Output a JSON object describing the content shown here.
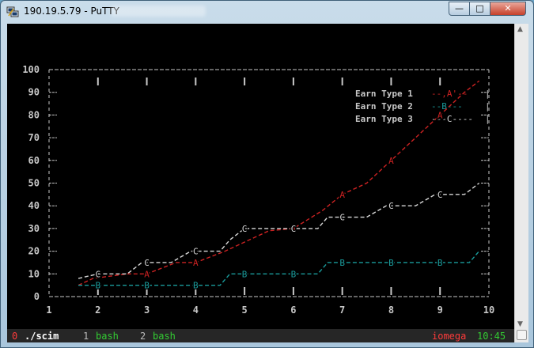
{
  "window": {
    "title": "190.19.5.79 - PuTTY",
    "controls": [
      "minimize-icon",
      "maximize-icon",
      "close-icon"
    ]
  },
  "colors": {
    "terminal_bg": "#000000",
    "axis": "#c8c8c8",
    "series_a": "#cc2222",
    "series_b": "#1a9c9c",
    "series_c": "#d8d8d8",
    "status_green": "#33cc33",
    "status_red": "#ff3b3b"
  },
  "chart_data": {
    "type": "line",
    "x": [
      1,
      2,
      3,
      4,
      5,
      6,
      7,
      8,
      9,
      10
    ],
    "xlim": [
      1,
      10
    ],
    "ylim": [
      0,
      100
    ],
    "y_ticks": [
      0,
      10,
      20,
      30,
      40,
      50,
      60,
      70,
      80,
      90,
      100
    ],
    "x_ticks": [
      1,
      2,
      3,
      4,
      5,
      6,
      7,
      8,
      9,
      10
    ],
    "legend_placement": "top-right",
    "series": [
      {
        "name": "Earn Type 1",
        "marker": "A",
        "line_style": "--,A'--",
        "points": [
          [
            1.6,
            5
          ],
          [
            1.9,
            8
          ],
          [
            2.6,
            10
          ],
          [
            3,
            10
          ],
          [
            3.6,
            15
          ],
          [
            4,
            15
          ],
          [
            4.6,
            20
          ],
          [
            5.5,
            29
          ],
          [
            6,
            30
          ],
          [
            6.6,
            38
          ],
          [
            7,
            45
          ],
          [
            7.5,
            50
          ],
          [
            8,
            60
          ],
          [
            8.5,
            70
          ],
          [
            9,
            80
          ],
          [
            9.5,
            90
          ],
          [
            9.8,
            95
          ]
        ]
      },
      {
        "name": "Earn Type 2",
        "marker": "B",
        "line_style": "--B---",
        "points": [
          [
            1.6,
            5
          ],
          [
            2,
            5
          ],
          [
            3,
            5
          ],
          [
            4,
            5
          ],
          [
            4.5,
            5
          ],
          [
            4.7,
            10
          ],
          [
            5,
            10
          ],
          [
            6,
            10
          ],
          [
            6.5,
            10
          ],
          [
            6.7,
            15
          ],
          [
            7,
            15
          ],
          [
            8,
            15
          ],
          [
            9,
            15
          ],
          [
            9.6,
            15
          ],
          [
            9.8,
            20
          ]
        ]
      },
      {
        "name": "Earn Type 3",
        "marker": "C",
        "line_style": "---C----",
        "points": [
          [
            1.6,
            8
          ],
          [
            2,
            10
          ],
          [
            2.6,
            10
          ],
          [
            2.9,
            15
          ],
          [
            3,
            15
          ],
          [
            3.5,
            15
          ],
          [
            3.9,
            20
          ],
          [
            4,
            20
          ],
          [
            4.5,
            20
          ],
          [
            4.7,
            25
          ],
          [
            5,
            30
          ],
          [
            6,
            30
          ],
          [
            6.5,
            30
          ],
          [
            6.7,
            35
          ],
          [
            7,
            35
          ],
          [
            7.5,
            35
          ],
          [
            7.9,
            40
          ],
          [
            8,
            40
          ],
          [
            8.5,
            40
          ],
          [
            8.9,
            45
          ],
          [
            9,
            45
          ],
          [
            9.5,
            45
          ],
          [
            9.8,
            50
          ]
        ]
      }
    ]
  },
  "status": {
    "window0": "0 ./scim",
    "window1_num": "1",
    "window1_name": "bash",
    "window2_num": "2",
    "window2_name": "bash",
    "host": "iomega",
    "clock": "10:45"
  }
}
